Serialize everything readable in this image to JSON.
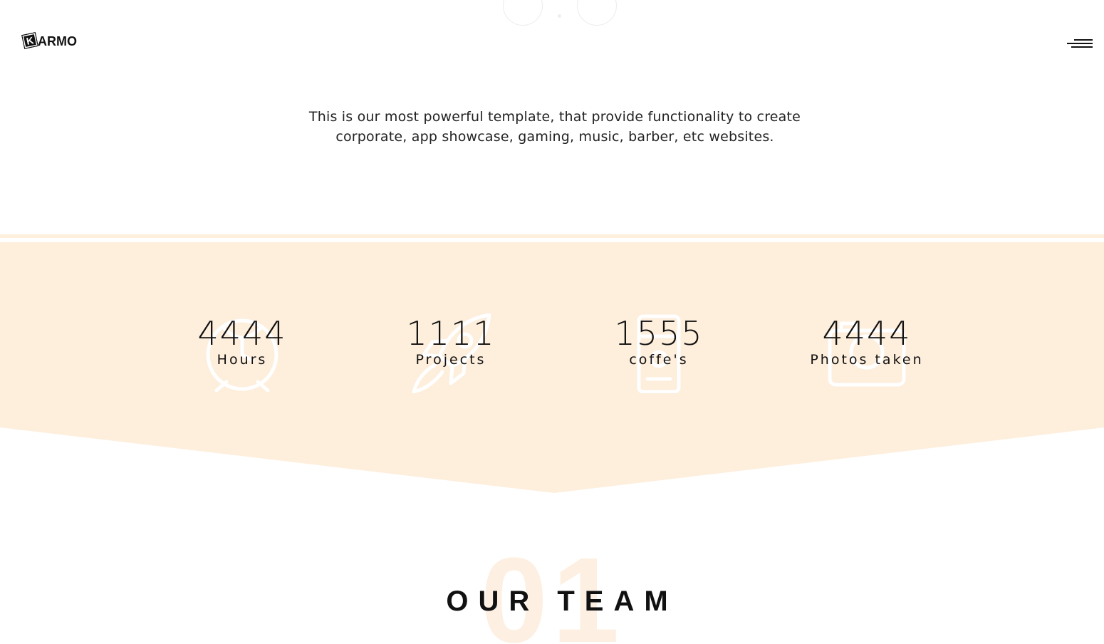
{
  "header": {
    "logo_mark": "K",
    "logo_text": "ARMO"
  },
  "intro": {
    "line1": "This is our most powerful template, that provide functionality to create",
    "line2": "corporate, app showcase, gaming, music, barber, etc websites."
  },
  "stats": [
    {
      "value": "4444",
      "label": "Hours",
      "icon": "alarm-clock-icon"
    },
    {
      "value": "1111",
      "label": "Projects",
      "icon": "rocket-icon"
    },
    {
      "value": "1555",
      "label": "coffe's",
      "icon": "coffee-machine-icon"
    },
    {
      "value": "4444",
      "label": "Photos taken",
      "icon": "camera-icon"
    }
  ],
  "team": {
    "number": "01",
    "title": "OUR TEAM"
  },
  "colors": {
    "band": "#feeedc",
    "icon_stroke": "#ffffff",
    "ghost_number": "#fdf0e2"
  }
}
